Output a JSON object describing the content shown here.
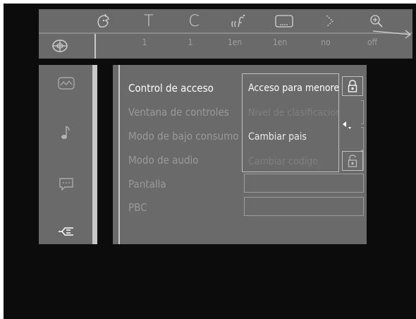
{
  "topbar": {
    "icons": [
      {
        "name": "angle-icon"
      },
      {
        "name": "title-icon",
        "glyph": "T"
      },
      {
        "name": "chapter-icon",
        "glyph": "C"
      },
      {
        "name": "audio-icon"
      },
      {
        "name": "subtitle-icon"
      },
      {
        "name": "slow-motion-icon"
      },
      {
        "name": "zoom-icon"
      }
    ],
    "values": [
      "1",
      "1",
      "1en",
      "1en",
      "no",
      "off"
    ]
  },
  "sidebar": {
    "categories": [
      {
        "name": "picture-settings-icon"
      },
      {
        "name": "audio-settings-icon"
      },
      {
        "name": "language-settings-icon"
      },
      {
        "name": "features-settings-icon"
      }
    ]
  },
  "menu": {
    "items": [
      {
        "label": "Control de acceso",
        "active": true
      },
      {
        "label": "Ventana de controles",
        "active": false
      },
      {
        "label": "Modo de bajo consumo",
        "active": false
      },
      {
        "label": "Modo de audio",
        "active": false
      },
      {
        "label": "Pantalla",
        "active": false
      },
      {
        "label": "PBC",
        "active": false
      }
    ]
  },
  "submenu": {
    "items": [
      {
        "label": "Acceso para menores",
        "state": "active"
      },
      {
        "label": "Nivel de clasificacion",
        "state": "disabled"
      },
      {
        "label": "Cambiar pais",
        "state": "normal"
      },
      {
        "label": "Cambiar codigo",
        "state": "disabled"
      }
    ]
  },
  "colors": {
    "panel": "#6a6a6a",
    "background": "#0c0c0c",
    "highlight": "#c8c8c8",
    "active_text": "#ffffff",
    "dim_text": "#9a9a9a"
  }
}
